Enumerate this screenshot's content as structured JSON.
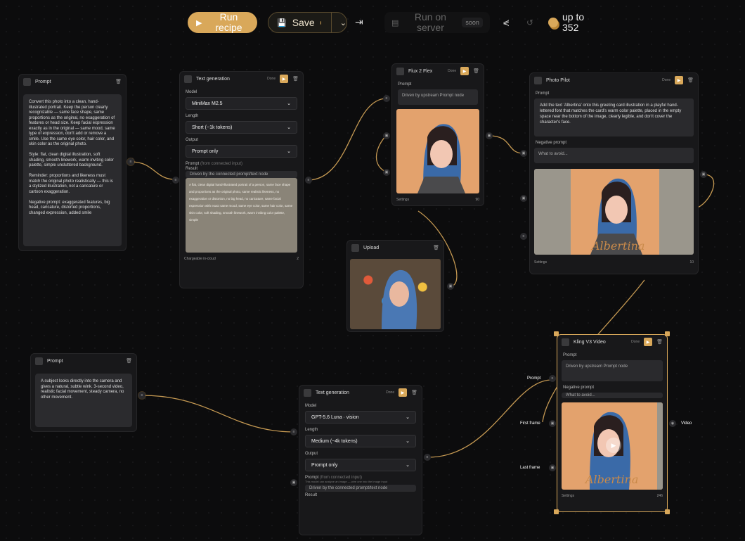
{
  "toolbar": {
    "run_label": "Run recipe",
    "save_label": "Save",
    "server_label": "Run on server",
    "soon_badge": "soon",
    "credits": "up to 352"
  },
  "colors": {
    "accent": "#d9a85a",
    "canvas": "#0c0c0d",
    "node": "#18181a"
  },
  "nodes": {
    "prompt1": {
      "title": "Prompt",
      "text_a": "Convert this photo into a clean, hand-illustrated portrait. Keep the person clearly recognizable — same face shape, same proportions as the original, no exaggeration of features or head size. Keep facial expression exactly as in the original — same mood, same type of expression, don't add or remove a smile. Use the same eye color, hair color, and skin color as the original photo.",
      "text_b": "Style: flat, clean digital illustration, soft shading, smooth linework, warm inviting color palette, simple uncluttered background.",
      "text_c": "Reminder: proportions and likeness must match the original photo realistically — this is a stylized illustration, not a caricature or cartoon exaggeration.",
      "text_d": "Negative prompt: exaggerated features, big head, caricature, distorted proportions, changed expression, added smile"
    },
    "textgen1": {
      "title": "Text generation",
      "status": "Done",
      "model_label": "Model",
      "model": "MiniMax M2.5",
      "length_label": "Length",
      "length": "Short (~1k tokens)",
      "output_label": "Output",
      "output": "Prompt only",
      "prompt_label": "Prompt",
      "prompt_hint": "(from connected input)",
      "prompt_placeholder": "Driven by the connected prompt/text node",
      "result_label": "Result",
      "result": "A flat, clean digital hand-illustrated portrait of a person, same face shape and proportions as the original photo, same realistic likeness, no exaggeration or distortion, no big head, no caricature, same facial expression with exact same mood, same eye color, same hair color, same skin color, soft shading, smooth linework, warm inviting color palette, simple",
      "footer": "Chargeable in-cloud",
      "cost": "2"
    },
    "flux": {
      "title": "Flux 2 Flex",
      "status": "Done",
      "prompt_label": "Prompt",
      "prompt_placeholder": "Driven by upstream Prompt node",
      "settings": "Settings",
      "cost": "90"
    },
    "photopilot": {
      "title": "Photo Pilot",
      "status": "Done",
      "prompt_label": "Prompt",
      "prompt": "Add the text 'Albertina' onto this greeting card illustration in a playful hand-lettered font that matches the card's warm color palette, placed in the empty space near the bottom of the image, clearly legible, and don't cover the character's face.",
      "neg_label": "Negative prompt",
      "neg_placeholder": "What to avoid...",
      "settings": "Settings",
      "cost": "10",
      "overlay": "Albertina"
    },
    "upload": {
      "title": "Upload"
    },
    "prompt2": {
      "title": "Prompt",
      "text": "A subject looks directly into the camera and gives a natural, subtle wink. 3-second video, realistic facial movement, steady camera, no other movement."
    },
    "textgen2": {
      "title": "Text generation",
      "status": "Done",
      "model_label": "Model",
      "model": "GPT-5.6 Luna · vision",
      "length_label": "Length",
      "length": "Medium (~4k tokens)",
      "output_label": "Output",
      "output": "Prompt only",
      "prompt_label": "Prompt",
      "prompt_hint": "(from connected input)",
      "prompt_note": "This model can analyze an image — wire one into the Image input",
      "prompt_placeholder": "Driven by the connected prompt/text node",
      "result_label": "Result"
    },
    "kling": {
      "title": "Kling V3 Video",
      "status": "Done",
      "prompt_label": "Prompt",
      "prompt_placeholder": "Driven by upstream Prompt node",
      "neg_label": "Negative prompt",
      "neg_placeholder": "What to avoid...",
      "settings": "Settings",
      "cost": "246",
      "overlay": "Albertina",
      "port_prompt": "Prompt",
      "port_first": "First frame",
      "port_last": "Last frame",
      "port_video": "Video"
    }
  }
}
